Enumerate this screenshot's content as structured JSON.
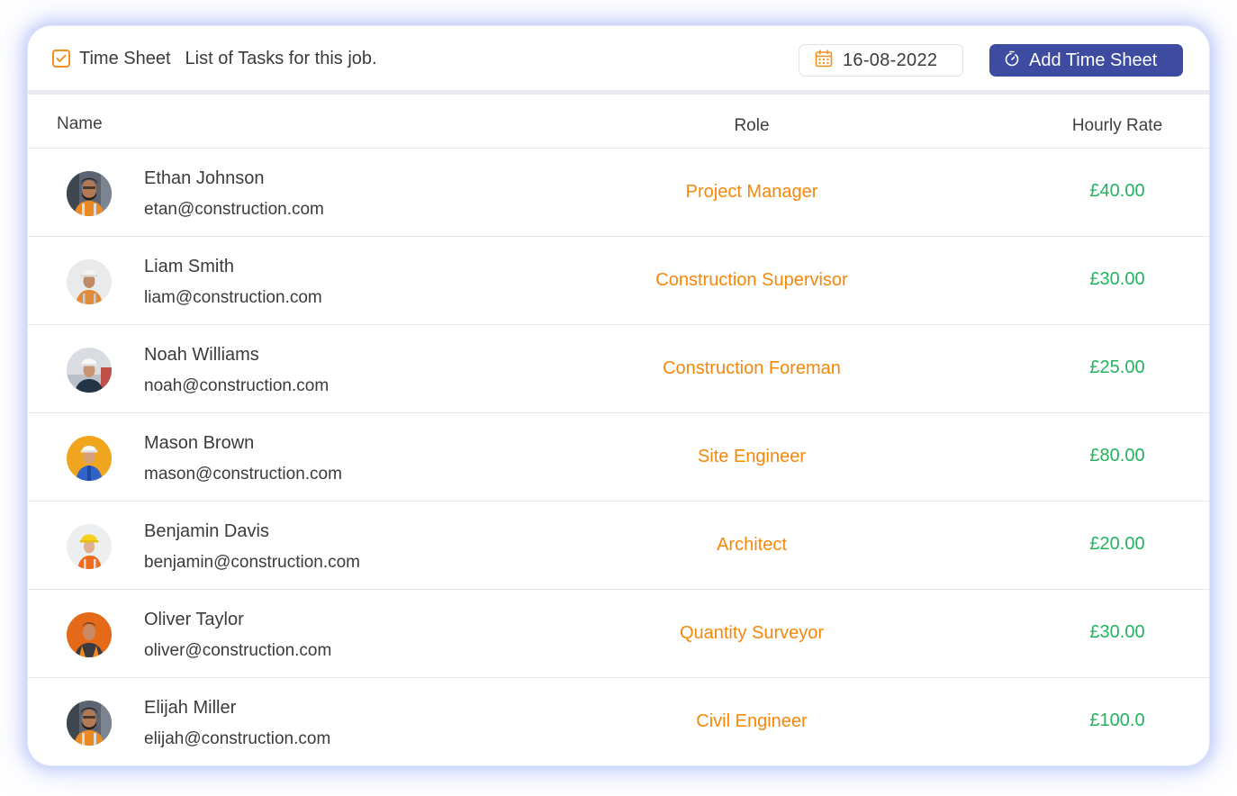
{
  "header": {
    "title": "Time Sheet",
    "subtitle": "List of Tasks for this job.",
    "date": "16-08-2022",
    "add_button_label": "Add Time Sheet"
  },
  "table": {
    "columns": {
      "name": "Name",
      "role": "Role",
      "rate": "Hourly Rate"
    },
    "rows": [
      {
        "name": "Ethan Johnson",
        "email": "etan@construction.com",
        "role": "Project Manager",
        "rate": "£40.00"
      },
      {
        "name": "Liam Smith",
        "email": "liam@construction.com",
        "role": "Construction Supervisor",
        "rate": "£30.00"
      },
      {
        "name": "Noah Williams",
        "email": "noah@construction.com",
        "role": "Construction Foreman",
        "rate": "£25.00"
      },
      {
        "name": "Mason Brown",
        "email": "mason@construction.com",
        "role": "Site Engineer",
        "rate": "£80.00"
      },
      {
        "name": "Benjamin Davis",
        "email": "benjamin@construction.com",
        "role": "Architect",
        "rate": "£20.00"
      },
      {
        "name": "Oliver Taylor",
        "email": "oliver@construction.com",
        "role": "Quantity Surveyor",
        "rate": "£30.00"
      },
      {
        "name": "Elijah Miller",
        "email": "elijah@construction.com",
        "role": "Civil Engineer",
        "rate": "£100.0"
      }
    ]
  },
  "colors": {
    "accent": "#3d4ba1",
    "role": "#f5870a",
    "rate": "#22b35e",
    "checkbox": "#f0901e"
  }
}
